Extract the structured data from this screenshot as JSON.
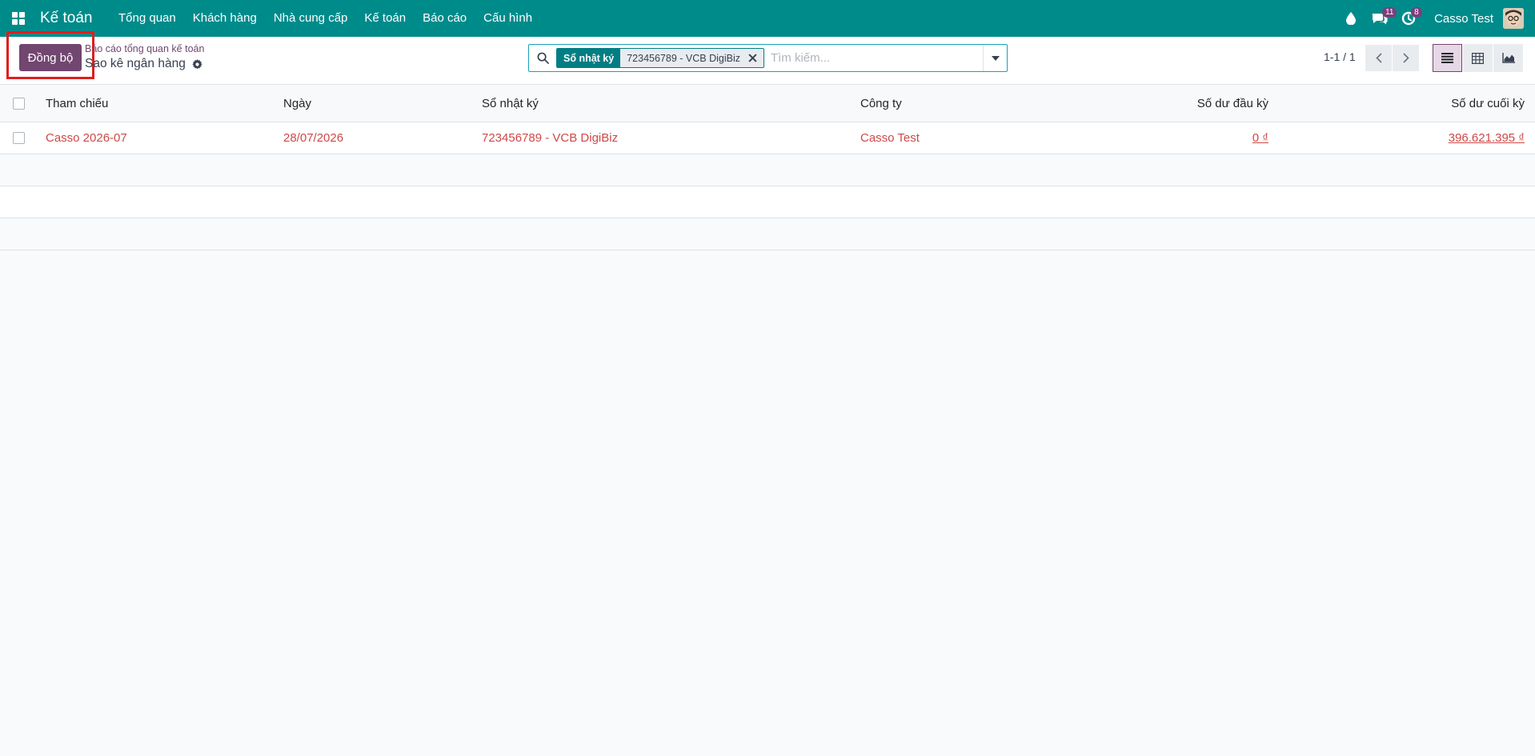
{
  "navbar": {
    "app_name": "Kế toán",
    "menu": [
      "Tổng quan",
      "Khách hàng",
      "Nhà cung cấp",
      "Kế toán",
      "Báo cáo",
      "Cấu hình"
    ],
    "messages_count": "11",
    "activities_count": "8",
    "user_name": "Casso Test",
    "icons": [
      "apps-grid-icon",
      "droplet-icon",
      "chat-icon",
      "clock-icon"
    ],
    "color": "#008b8b"
  },
  "control": {
    "sync_label": "Đồng bộ",
    "breadcrumb": "Báo cáo tổng quan kế toán",
    "title": "Sao kê ngân hàng",
    "search": {
      "facet_label": "Sổ nhật ký",
      "facet_value": "723456789 - VCB DigiBiz",
      "placeholder": "Tìm kiếm..."
    },
    "pager": "1-1 / 1",
    "accent_color": "#71466f"
  },
  "table": {
    "columns": [
      "Tham chiếu",
      "Ngày",
      "Sổ nhật ký",
      "Công ty",
      "Số dư đầu kỳ",
      "Số dư cuối kỳ"
    ],
    "rows": [
      {
        "reference": "Casso 2026-07",
        "date": "28/07/2026",
        "journal": "723456789 - VCB DigiBiz",
        "company": "Casso Test",
        "opening_balance": "0 ₫",
        "closing_balance": "396.621.395 ₫"
      }
    ]
  }
}
